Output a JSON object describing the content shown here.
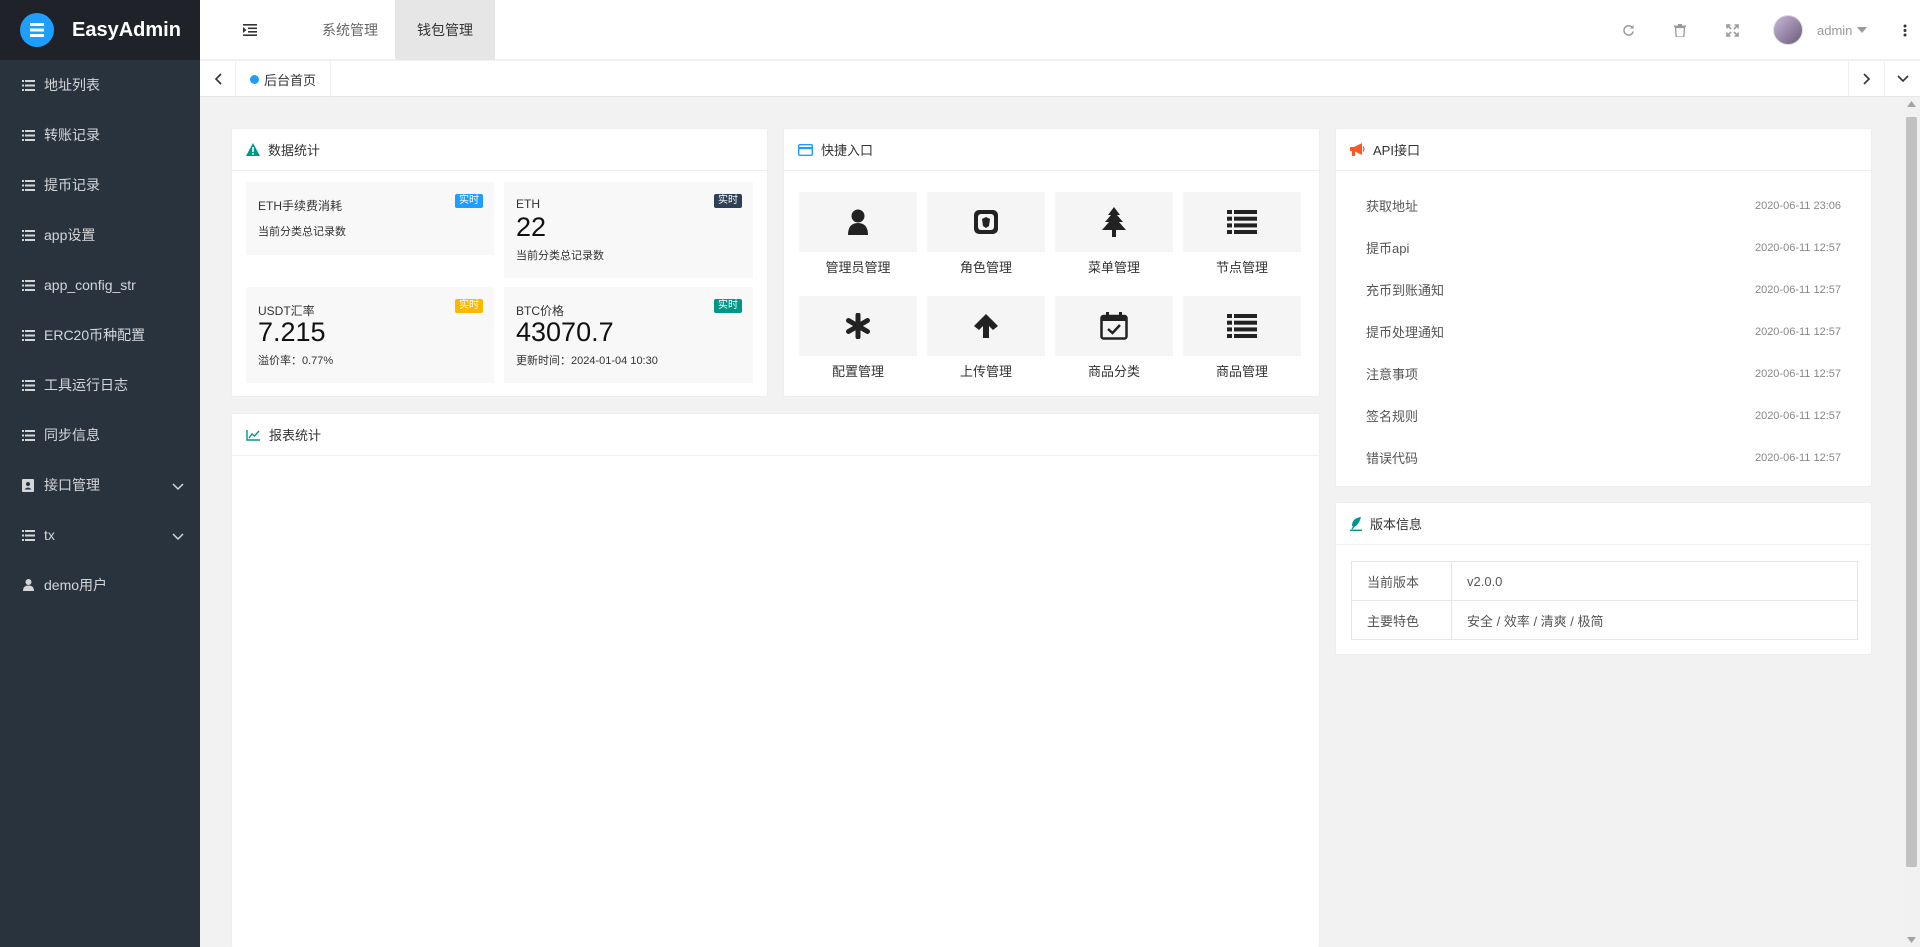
{
  "app": {
    "title": "EasyAdmin"
  },
  "sidebar": {
    "items": [
      {
        "label": "地址列表",
        "icon": "list-icon"
      },
      {
        "label": "转账记录",
        "icon": "list-icon"
      },
      {
        "label": "提币记录",
        "icon": "list-icon"
      },
      {
        "label": "app设置",
        "icon": "list-icon"
      },
      {
        "label": "app_config_str",
        "icon": "list-icon"
      },
      {
        "label": "ERC20币种配置",
        "icon": "list-icon"
      },
      {
        "label": "工具运行日志",
        "icon": "list-icon"
      },
      {
        "label": "同步信息",
        "icon": "list-icon"
      },
      {
        "label": "接口管理",
        "icon": "address-book-icon"
      },
      {
        "label": "tx",
        "icon": "list-icon"
      },
      {
        "label": "demo用户",
        "icon": "user-icon"
      }
    ]
  },
  "header": {
    "tabs": [
      {
        "label": "系统管理"
      },
      {
        "label": "钱包管理"
      }
    ],
    "active_tab": "钱包管理",
    "user": "admin"
  },
  "tabbar": {
    "home_label": "后台首页"
  },
  "stats": {
    "title": "数据统计",
    "items": [
      {
        "name": "ETH手续费消耗",
        "badge": "实时",
        "value": "",
        "desc": "当前分类总记录数",
        "badge_color": "#1e9fff"
      },
      {
        "name": "ETH",
        "badge": "实时",
        "value": "22",
        "desc": "当前分类总记录数",
        "badge_color": "#2f4056"
      },
      {
        "name": "USDT汇率",
        "badge": "实时",
        "value": "7.215",
        "desc": "溢价率：0.77%",
        "badge_color": "#ffb800"
      },
      {
        "name": "BTC价格",
        "badge": "实时",
        "value": "43070.7",
        "desc": "更新时间：2024-01-04 10:30",
        "badge_color": "#009688"
      }
    ]
  },
  "quick": {
    "title": "快捷入口",
    "items": [
      {
        "label": "管理员管理",
        "icon": "user-icon"
      },
      {
        "label": "角色管理",
        "icon": "role-icon"
      },
      {
        "label": "菜单管理",
        "icon": "tree-icon"
      },
      {
        "label": "节点管理",
        "icon": "list-icon"
      },
      {
        "label": "配置管理",
        "icon": "asterisk-icon"
      },
      {
        "label": "上传管理",
        "icon": "arrow-up-icon"
      },
      {
        "label": "商品分类",
        "icon": "calendar-check-icon"
      },
      {
        "label": "商品管理",
        "icon": "list-icon"
      }
    ]
  },
  "report": {
    "title": "报表统计"
  },
  "api": {
    "title": "API接口",
    "items": [
      {
        "title": "获取地址",
        "date": "2020-06-11 23:06"
      },
      {
        "title": "提币api",
        "date": "2020-06-11 12:57"
      },
      {
        "title": "充币到账通知",
        "date": "2020-06-11 12:57"
      },
      {
        "title": "提币处理通知",
        "date": "2020-06-11 12:57"
      },
      {
        "title": "注意事项",
        "date": "2020-06-11 12:57"
      },
      {
        "title": "签名规则",
        "date": "2020-06-11 12:57"
      },
      {
        "title": "错误代码",
        "date": "2020-06-11 12:57"
      }
    ]
  },
  "version": {
    "title": "版本信息",
    "rows": [
      {
        "key": "当前版本",
        "value": "v2.0.0"
      },
      {
        "key": "主要特色",
        "value": "安全 / 效率 / 清爽 / 极简"
      }
    ]
  },
  "colors": {
    "sidebar": "#28333e",
    "logo_bg": "#20222a",
    "accent": "#1e9fff"
  }
}
